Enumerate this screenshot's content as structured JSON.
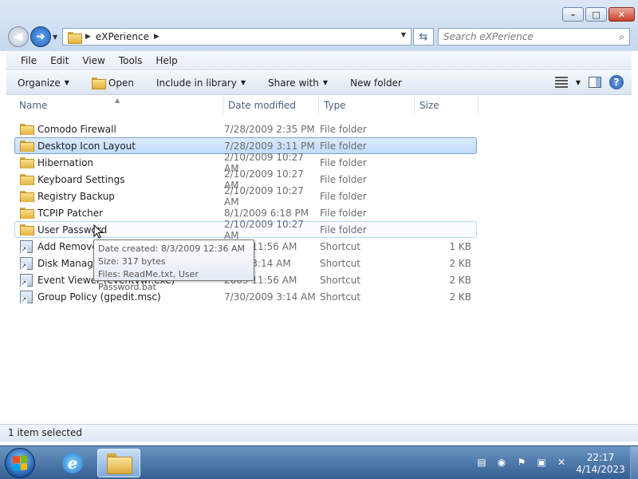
{
  "window": {
    "address_crumb": "eXPerience",
    "search_placeholder": "Search eXPerience",
    "minimize": "–",
    "maximize": "□",
    "close": "✕"
  },
  "menu": [
    "File",
    "Edit",
    "View",
    "Tools",
    "Help"
  ],
  "toolbar": {
    "organize": "Organize",
    "open": "Open",
    "include_in_library": "Include in library",
    "share_with": "Share with",
    "new_folder": "New folder"
  },
  "columns": {
    "name": "Name",
    "date_modified": "Date modified",
    "type": "Type",
    "size": "Size"
  },
  "files": [
    {
      "name": "Comodo Firewall",
      "date": "7/28/2009 2:35 PM",
      "type": "File folder",
      "size": "",
      "kind": "folder"
    },
    {
      "name": "Desktop Icon Layout",
      "date": "7/28/2009 3:11 PM",
      "type": "File folder",
      "size": "",
      "kind": "folder"
    },
    {
      "name": "Hibernation",
      "date": "2/10/2009 10:27 AM",
      "type": "File folder",
      "size": "",
      "kind": "folder"
    },
    {
      "name": "Keyboard Settings",
      "date": "2/10/2009 10:27 AM",
      "type": "File folder",
      "size": "",
      "kind": "folder"
    },
    {
      "name": "Registry Backup",
      "date": "2/10/2009 10:27 AM",
      "type": "File folder",
      "size": "",
      "kind": "folder"
    },
    {
      "name": "TCPIP Patcher",
      "date": "8/1/2009 6:18 PM",
      "type": "File folder",
      "size": "",
      "kind": "folder"
    },
    {
      "name": "User Password",
      "date": "2/10/2009 10:27 AM",
      "type": "File folder",
      "size": "",
      "kind": "folder"
    },
    {
      "name": "Add Remove",
      "date": "2009 11:56 AM",
      "type": "Shortcut",
      "size": "1 KB",
      "kind": "shortcut"
    },
    {
      "name": "Disk Manager",
      "date": "2009 3:14 AM",
      "type": "Shortcut",
      "size": "2 KB",
      "kind": "shortcut"
    },
    {
      "name": "Event Viewer (eventvwr.exe)",
      "date": "2009 11:56 AM",
      "type": "Shortcut",
      "size": "2 KB",
      "kind": "shortcut"
    },
    {
      "name": "Group Policy (gpedit.msc)",
      "date": "7/30/2009 3:14 AM",
      "type": "Shortcut",
      "size": "2 KB",
      "kind": "shortcut"
    }
  ],
  "selected_index": 1,
  "hover_index": 6,
  "tooltip": {
    "line1": "Date created: 8/3/2009 12:36 AM",
    "line2": "Size: 317 bytes",
    "line3": "Files: ReadMe.txt, User Password.bat"
  },
  "status": "1 item selected",
  "clock": {
    "time": "22:17",
    "date": "4/14/2023"
  },
  "colors": {
    "selection_bg": "#c9e0fc",
    "selection_border": "#7da2ce",
    "taskbar": "#4a76a8"
  }
}
